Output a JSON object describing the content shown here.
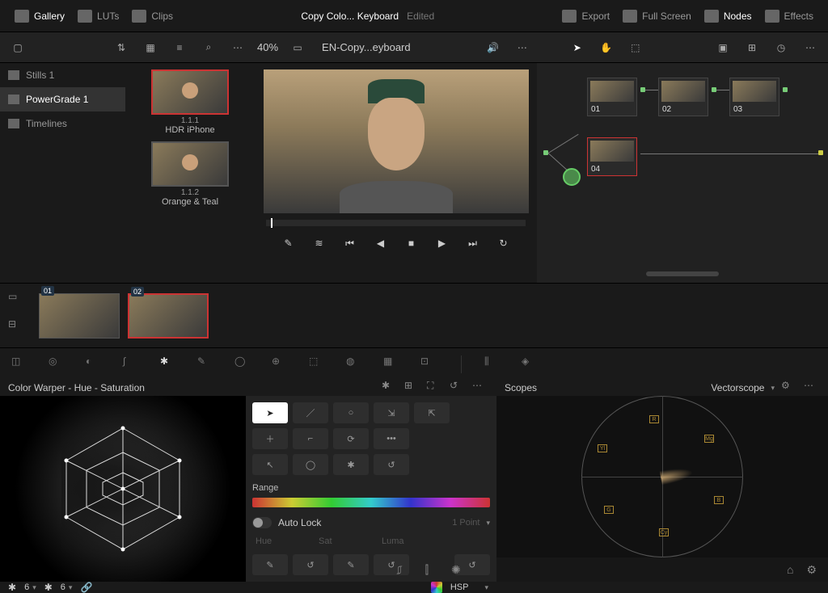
{
  "top": {
    "gallery": "Gallery",
    "luts": "LUTs",
    "clips": "Clips",
    "title": "Copy Colo... Keyboard",
    "status": "Edited",
    "export": "Export",
    "fullscreen": "Full Screen",
    "nodes": "Nodes",
    "effects": "Effects"
  },
  "tool": {
    "zoom": "40%",
    "clip": "EN-Copy...eyboard"
  },
  "left": {
    "items": [
      "Stills 1",
      "PowerGrade 1",
      "Timelines"
    ]
  },
  "stills": [
    {
      "id": "1.1.1",
      "name": "HDR iPhone"
    },
    {
      "id": "1.1.2",
      "name": "Orange & Teal"
    }
  ],
  "nodes": [
    {
      "n": "01"
    },
    {
      "n": "02"
    },
    {
      "n": "03"
    },
    {
      "n": "04"
    }
  ],
  "clips": [
    {
      "n": "01"
    },
    {
      "n": "02"
    }
  ],
  "cw": {
    "title": "Color Warper - Hue - Saturation",
    "range": "Range",
    "autolock": "Auto Lock",
    "point": "1 Point",
    "p_hue": "Hue",
    "p_sat": "Sat",
    "p_luma": "Luma",
    "hval": "6",
    "sval": "6",
    "space": "HSP"
  },
  "scopes": {
    "title": "Scopes",
    "mode": "Vectorscope",
    "targets": [
      "R",
      "Mg",
      "B",
      "Cy",
      "G",
      "Yl"
    ]
  }
}
